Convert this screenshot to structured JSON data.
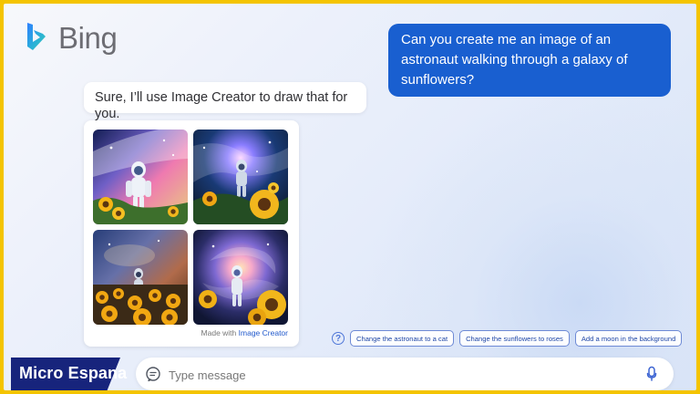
{
  "branding": {
    "name": "Bing",
    "logo_icon": "bing-logo-icon"
  },
  "conversation": {
    "user_message": "Can you create me an image of an astronaut walking through a galaxy of sunflowers?",
    "assistant_message": "Sure, I’ll use Image Creator to draw that for you."
  },
  "image_result": {
    "made_with_prefix": "Made with",
    "made_with_link": "Image Creator",
    "image_icons": [
      "astronaut-sunflower-image-1",
      "astronaut-sunflower-image-2",
      "astronaut-sunflower-image-3",
      "astronaut-sunflower-image-4"
    ]
  },
  "suggestions": {
    "help_icon": "question-icon",
    "items": [
      "Change the astronaut to a cat",
      "Change the sunflowers to roses",
      "Add a moon in the background"
    ]
  },
  "input": {
    "placeholder": "Type message",
    "left_icon": "chat-bubble-icon",
    "right_icon": "microphone-icon"
  },
  "watermark": {
    "text": "Micro Espana"
  },
  "colors": {
    "frame_yellow": "#f4c400",
    "user_bubble": "#195fd0",
    "accent_blue": "#225acc",
    "watermark_navy": "#17247c"
  }
}
